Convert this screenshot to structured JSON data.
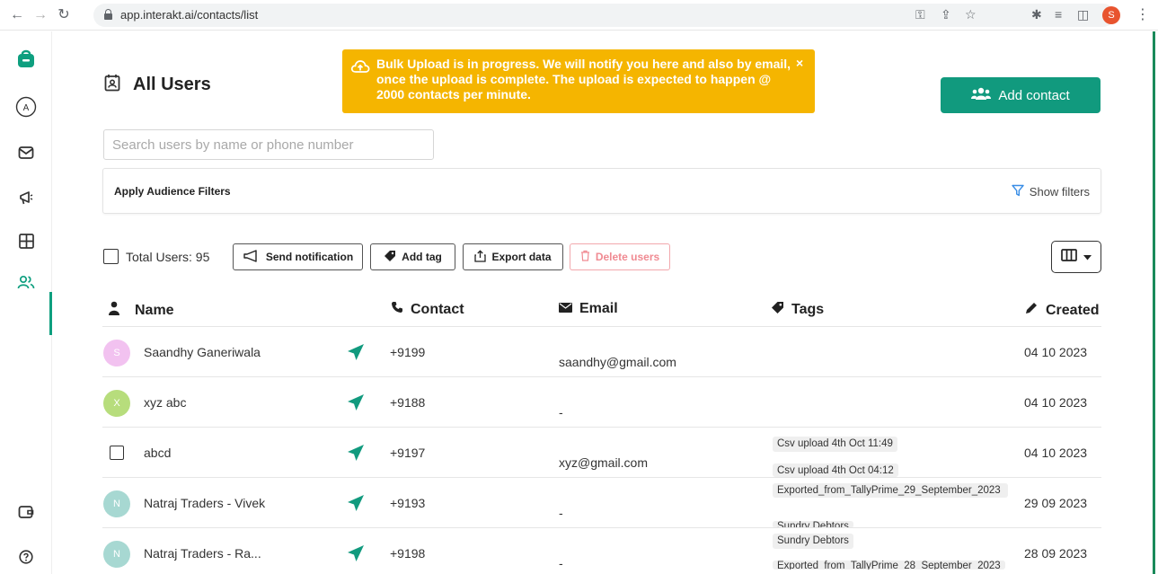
{
  "browser": {
    "url": "app.interakt.ai/contacts/list",
    "profile_initial": "S"
  },
  "page": {
    "title": "All Users",
    "add_contact_label": "Add contact"
  },
  "toast": {
    "message": "Bulk Upload is in progress. We will notify you here and also by email, once the upload is complete. The upload is expected to happen @ 2000 contacts per minute.",
    "close_label": "×"
  },
  "search": {
    "placeholder": "Search users by name or phone number"
  },
  "filters": {
    "title": "Apply Audience Filters",
    "show_label": "Show filters"
  },
  "toolbar": {
    "total_label": "Total Users: 95",
    "send_notification": "Send notification",
    "add_tag": "Add tag",
    "export_data": "Export data",
    "delete_users": "Delete users"
  },
  "table": {
    "headers": {
      "name": "Name",
      "contact": "Contact",
      "email": "Email",
      "tags": "Tags",
      "created": "Created"
    },
    "rows": [
      {
        "initial": "S",
        "avatar_color": "#f2c2f0",
        "name": "Saandhy Ganeriwala",
        "contact": "+9199",
        "email": "saandhy@gmail.com",
        "tags": [],
        "created": "04 10 2023"
      },
      {
        "initial": "X",
        "avatar_color": "#b7dd7c",
        "name": "xyz abc",
        "contact": "+9188",
        "email": "-",
        "tags": [],
        "created": "04 10 2023"
      },
      {
        "initial": "",
        "avatar_color": "",
        "name": "abcd",
        "contact": "+9197",
        "email": "xyz@gmail.com",
        "tags": [
          "Csv upload 4th Oct 11:49",
          "Csv upload 4th Oct 04:12"
        ],
        "created": "04 10 2023"
      },
      {
        "initial": "N",
        "avatar_color": "#a7d8d2",
        "name": "Natraj Traders - Vivek",
        "contact": "+9193",
        "email": "-",
        "tags": [
          "Exported_from_TallyPrime_29_September_2023",
          "Sundry Debtors"
        ],
        "created": "29 09 2023"
      },
      {
        "initial": "N",
        "avatar_color": "#a7d8d2",
        "name": "Natraj Traders - Ra...",
        "contact": "+9198",
        "email": "-",
        "tags": [
          "Sundry Debtors",
          "Exported_from_TallyPrime_28_September_2023"
        ],
        "created": "28 09 2023"
      }
    ]
  },
  "colors": {
    "accent": "#119a7e",
    "toast": "#f5b500",
    "danger": "#f08a92"
  }
}
